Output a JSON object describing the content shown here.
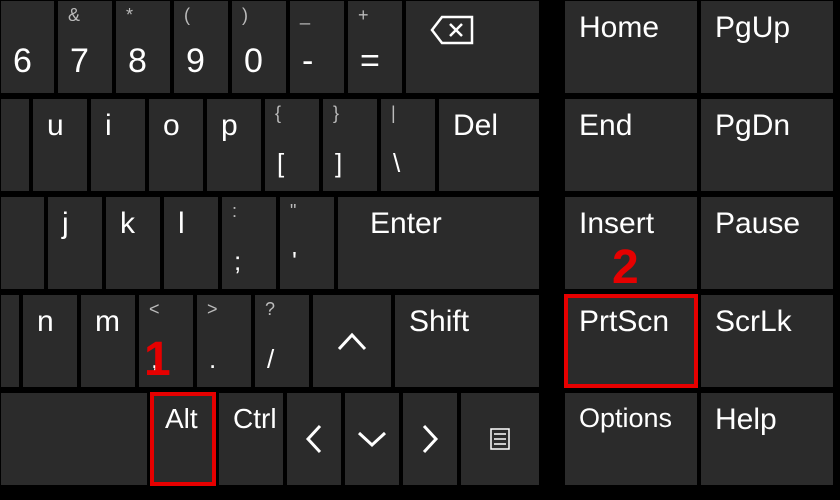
{
  "row1": {
    "k6": {
      "top": "",
      "main": "6"
    },
    "k7": {
      "top": "&",
      "main": "7"
    },
    "k8": {
      "top": "*",
      "main": "8"
    },
    "k9": {
      "top": "(",
      "main": "9"
    },
    "k0": {
      "top": ")",
      "main": "0"
    },
    "kminus": {
      "top": "_",
      "main": "-"
    },
    "kequal": {
      "top": "+",
      "main": "="
    },
    "backspace": "⌫"
  },
  "row2": {
    "u": "u",
    "i": "i",
    "o": "o",
    "p": "p",
    "lb": {
      "top": "{",
      "main": "["
    },
    "rb": {
      "top": "}",
      "main": "]"
    },
    "bs": {
      "top": "|",
      "main": "\\"
    },
    "del": "Del"
  },
  "row3": {
    "j": "j",
    "k": "k",
    "l": "l",
    "semi": {
      "top": ":",
      "main": ";"
    },
    "quote": {
      "top": "\"",
      "main": "'"
    },
    "enter": "Enter"
  },
  "row4": {
    "n": "n",
    "m": "m",
    "comma": {
      "top": "<",
      "main": ","
    },
    "period": {
      "top": ">",
      "main": "."
    },
    "slash": {
      "top": "?",
      "main": "/"
    },
    "up": "",
    "shift": "Shift"
  },
  "row5": {
    "alt": "Alt",
    "ctrl": "Ctrl",
    "left": "",
    "down": "",
    "right": "",
    "menu": ""
  },
  "nav": {
    "home": "Home",
    "pgup": "PgUp",
    "end": "End",
    "pgdn": "PgDn",
    "insert": "Insert",
    "pause": "Pause",
    "prtscn": "PrtScn",
    "scrlk": "ScrLk",
    "options": "Options",
    "help": "Help"
  },
  "annotations": {
    "one": "1",
    "two": "2"
  },
  "highlights": [
    "alt",
    "prtscn"
  ],
  "chart_data": null
}
